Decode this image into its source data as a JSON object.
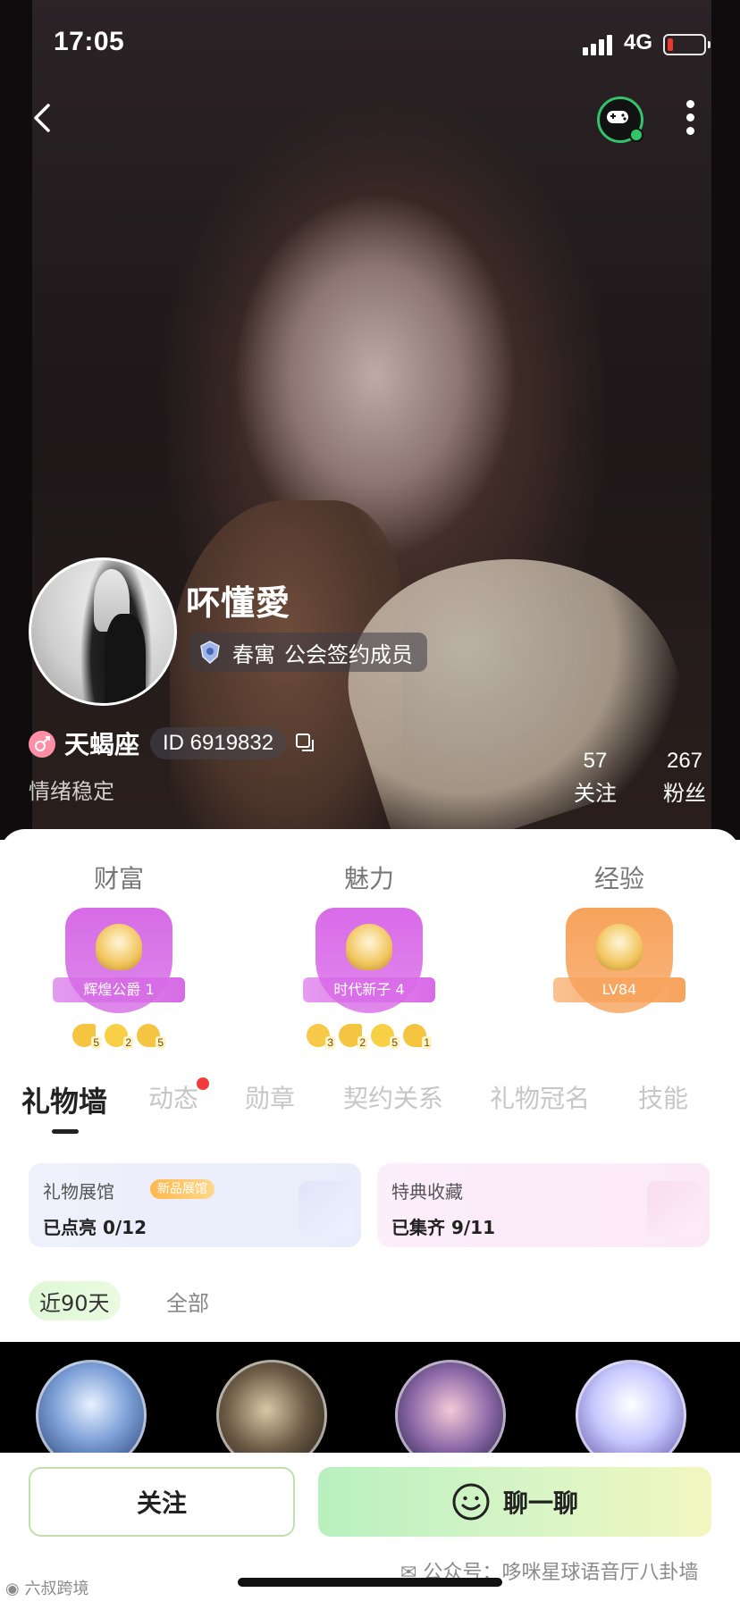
{
  "status_bar": {
    "time": "17:05",
    "network": "4G"
  },
  "profile": {
    "nickname": "吥懂愛",
    "guild_name": "春寓",
    "guild_role": "公会签约成员",
    "zodiac": "天蝎座",
    "id_text": "ID 6919832",
    "signature": "情绪稳定",
    "following_count": "57",
    "following_label": "关注",
    "fans_count": "267",
    "fans_label": "粉丝"
  },
  "levels": [
    {
      "title": "财富",
      "badge": "辉煌公爵 1",
      "emblem_num": "1",
      "color": "#d66be6",
      "medals": [
        {
          "icon": "moon-icon",
          "count": "5"
        },
        {
          "icon": "star-icon",
          "count": "2"
        },
        {
          "icon": "heart-icon",
          "count": "5"
        }
      ]
    },
    {
      "title": "魅力",
      "badge": "时代新子 4",
      "emblem_num": "4",
      "color": "#d96be8",
      "medals": [
        {
          "icon": "sun-icon",
          "count": "3"
        },
        {
          "icon": "moon-icon",
          "count": "2"
        },
        {
          "icon": "star-icon",
          "count": "5"
        },
        {
          "icon": "heart-icon",
          "count": "1"
        }
      ]
    },
    {
      "title": "经验",
      "badge": "LV84",
      "emblem_num": "",
      "color": "#f7a35c",
      "medals": []
    }
  ],
  "tabs": [
    "礼物墙",
    "动态",
    "勋章",
    "契约关系",
    "礼物冠名",
    "技能"
  ],
  "cards": {
    "gallery": {
      "title": "礼物展馆",
      "tag": "新品展馆",
      "status": "已点亮 0/12"
    },
    "collection": {
      "title": "特典收藏",
      "status": "已集齐 9/11"
    }
  },
  "filters": {
    "recent": "近90天",
    "all": "全部"
  },
  "actions": {
    "follow": "关注",
    "chat": "聊一聊"
  },
  "watermarks": {
    "wechat": "公众号：哆咪星球语音厅八卦墙",
    "weibo": "六叔跨境"
  },
  "colors": {
    "accent_green": "#33c46a",
    "tab_dot": "#f23b3b"
  }
}
